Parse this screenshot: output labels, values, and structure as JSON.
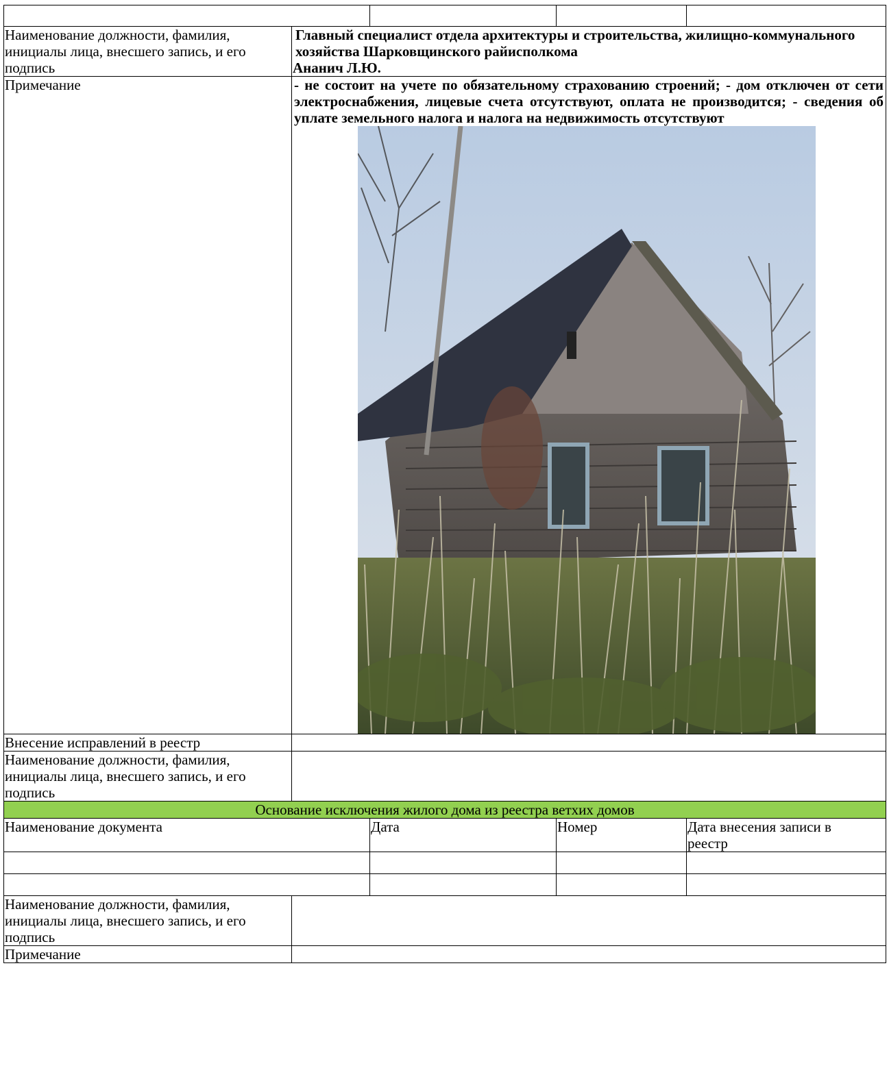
{
  "top_row": [
    "",
    "",
    "",
    ""
  ],
  "entry": {
    "official_label": "Наименование должности, фамилия, инициалы лица, внесшего запись, и его подпись",
    "official_value_line1": "Главный специалист отдела архитектуры и строительства, жилищно-коммунального хозяйства Шарковщинского райисполкома",
    "official_value_line2": "Ананич Л.Ю.",
    "note_label": "Примечание",
    "note_value": "- не состоит на учете по обязательному страхованию строений; - дом отключен от сети электроснабжения, лицевые счета отсутствуют, оплата не производится; - сведения об уплате земельного налога и налога на недвижимость отсутствуют"
  },
  "corrections": {
    "label": "Внесение исправлений в реестр",
    "value": "",
    "official_label": "Наименование должности, фамилия, инициалы лица, внесшего запись, и его подпись",
    "official_value": ""
  },
  "exclusion": {
    "header": "Основание исключения жилого дома из реестра ветхих домов",
    "columns": [
      "Наименование документа",
      "Дата",
      "Номер",
      "Дата внесения записи в реестр"
    ],
    "rows": [
      [
        "",
        "",
        "",
        ""
      ],
      [
        "",
        "",
        "",
        ""
      ]
    ],
    "official_label": "Наименование должности, фамилия, инициалы лица, внесшего запись, и его подпись",
    "official_value": "",
    "note_label": "Примечание",
    "note_value": ""
  },
  "colors": {
    "header_green": "#92d050",
    "sky": "#c9d6e6",
    "roof": "#2f3340",
    "wood": "#6e6a68",
    "grass": "#5e6a3a"
  }
}
